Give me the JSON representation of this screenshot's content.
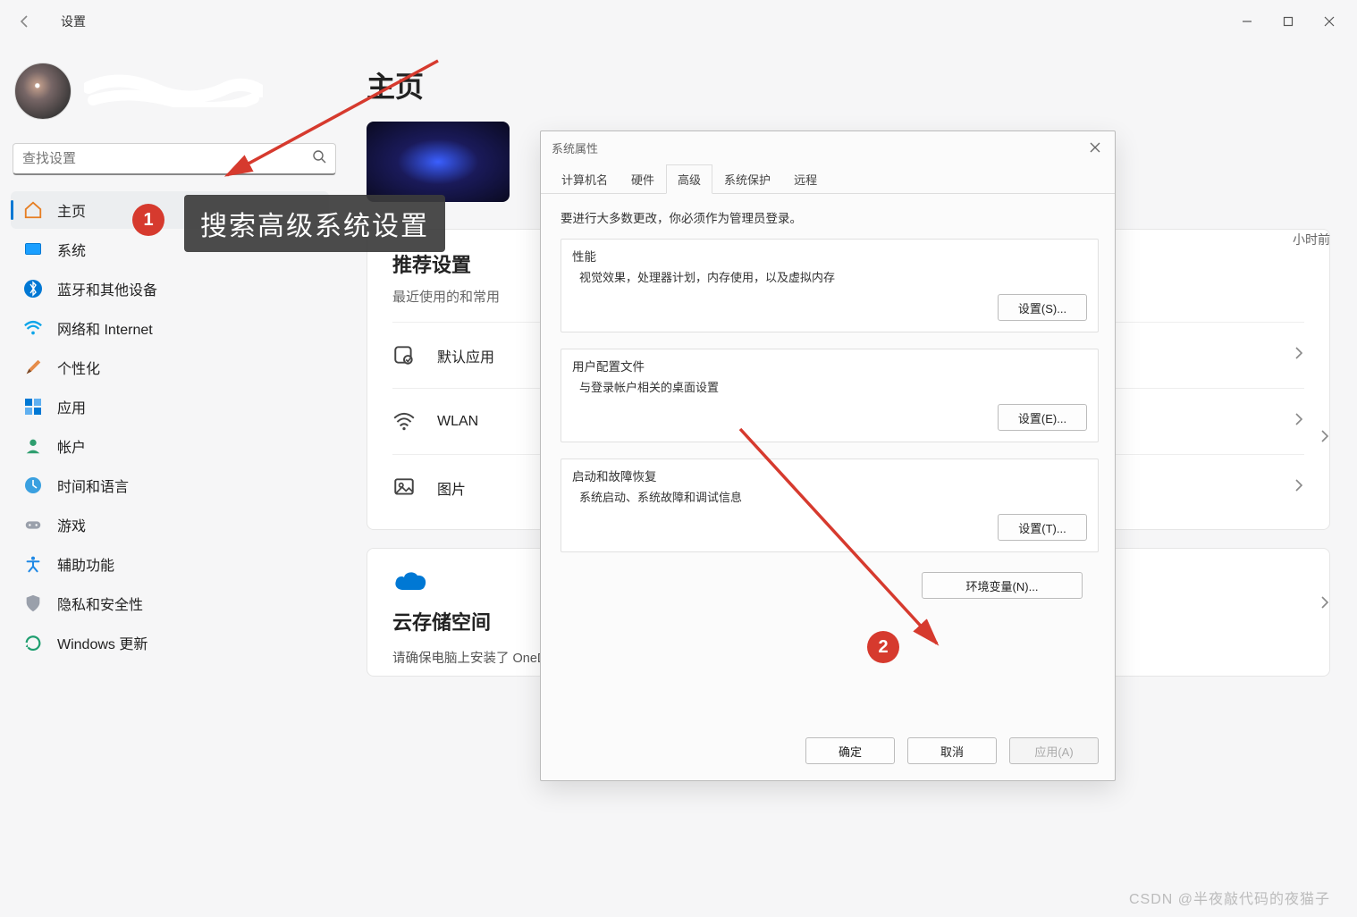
{
  "titlebar": {
    "app_title": "设置"
  },
  "search": {
    "placeholder": "查找设置"
  },
  "page": {
    "title": "主页"
  },
  "right_meta": "小时前",
  "sidebar": {
    "items": [
      {
        "label": "主页",
        "icon": "home"
      },
      {
        "label": "系统",
        "icon": "system"
      },
      {
        "label": "蓝牙和其他设备",
        "icon": "bluetooth"
      },
      {
        "label": "网络和 Internet",
        "icon": "wifi"
      },
      {
        "label": "个性化",
        "icon": "brush"
      },
      {
        "label": "应用",
        "icon": "apps"
      },
      {
        "label": "帐户",
        "icon": "account"
      },
      {
        "label": "时间和语言",
        "icon": "timelang"
      },
      {
        "label": "游戏",
        "icon": "gaming"
      },
      {
        "label": "辅助功能",
        "icon": "accessibility"
      },
      {
        "label": "隐私和安全性",
        "icon": "privacy"
      },
      {
        "label": "Windows 更新",
        "icon": "update"
      }
    ]
  },
  "recommended": {
    "title": "推荐设置",
    "subtitle": "最近使用的和常用",
    "rows": [
      {
        "label": "默认应用"
      },
      {
        "label": "WLAN"
      },
      {
        "label": "图片"
      }
    ]
  },
  "cloud": {
    "title": "云存储空间",
    "subtitle_cut": "请确保电脑上安装了 OneDrive，以便可以在此处查看存储详细信息"
  },
  "dialog": {
    "title": "系统属性",
    "tabs": [
      "计算机名",
      "硬件",
      "高级",
      "系统保护",
      "远程"
    ],
    "active_tab": "高级",
    "note": "要进行大多数更改，你必须作为管理员登录。",
    "groups": {
      "perf": {
        "title": "性能",
        "desc": "视觉效果，处理器计划，内存使用，以及虚拟内存",
        "btn": "设置(S)..."
      },
      "profile": {
        "title": "用户配置文件",
        "desc": "与登录帐户相关的桌面设置",
        "btn": "设置(E)..."
      },
      "startup": {
        "title": "启动和故障恢复",
        "desc": "系统启动、系统故障和调试信息",
        "btn": "设置(T)..."
      }
    },
    "env_btn": "环境变量(N)...",
    "footer": {
      "ok": "确定",
      "cancel": "取消",
      "apply": "应用(A)"
    }
  },
  "annotations": {
    "tip": "搜索高级系统设置",
    "badge1": "1",
    "badge2": "2",
    "watermark": "CSDN @半夜敲代码的夜猫子"
  }
}
